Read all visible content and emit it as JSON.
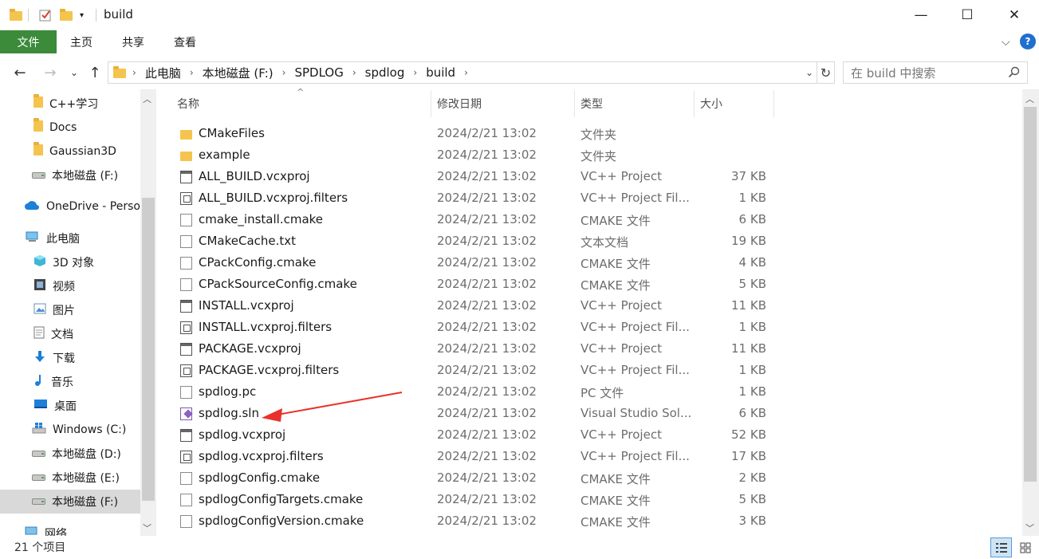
{
  "window": {
    "title": "build",
    "minimize_glyph": "—",
    "maximize_glyph": "☐",
    "close_glyph": "✕"
  },
  "ribbon": {
    "tabs": [
      "文件",
      "主页",
      "共享",
      "查看"
    ],
    "accent": "#3b8b3a",
    "expand_glyph": "⌵",
    "help_glyph": "?"
  },
  "nav": {
    "back": "←",
    "forward": "→",
    "recent": "⌄",
    "up": "↑",
    "breadcrumb": [
      "此电脑",
      "本地磁盘 (F:)",
      "SPDLOG",
      "spdlog",
      "build"
    ],
    "refresh": "↻"
  },
  "search": {
    "placeholder": "在 build 中搜索"
  },
  "sidebar": {
    "items": [
      {
        "label": "C++学习",
        "icon": "folder-icon"
      },
      {
        "label": "Docs",
        "icon": "folder-icon"
      },
      {
        "label": "Gaussian3D",
        "icon": "folder-icon"
      },
      {
        "label": "本地磁盘 (F:)",
        "icon": "drive-icon"
      },
      {
        "label": "OneDrive - Perso",
        "icon": "cloud-icon"
      },
      {
        "label": "此电脑",
        "icon": "computer-icon"
      },
      {
        "label": "3D 对象",
        "icon": "cube-icon"
      },
      {
        "label": "视频",
        "icon": "video-icon"
      },
      {
        "label": "图片",
        "icon": "picture-icon"
      },
      {
        "label": "文档",
        "icon": "document-icon"
      },
      {
        "label": "下载",
        "icon": "download-icon"
      },
      {
        "label": "音乐",
        "icon": "music-icon"
      },
      {
        "label": "桌面",
        "icon": "desktop-icon"
      },
      {
        "label": "Windows (C:)",
        "icon": "windows-drive-icon"
      },
      {
        "label": "本地磁盘 (D:)",
        "icon": "drive-icon"
      },
      {
        "label": "本地磁盘 (E:)",
        "icon": "drive-icon"
      },
      {
        "label": "本地磁盘 (F:)",
        "icon": "drive-icon"
      },
      {
        "label": "网络",
        "icon": "network-icon"
      }
    ]
  },
  "columns": {
    "name": "名称",
    "date": "修改日期",
    "type": "类型",
    "size": "大小"
  },
  "files": [
    {
      "name": "CMakeFiles",
      "date": "2024/2/21 13:02",
      "type": "文件夹",
      "size": "",
      "icon": "folder"
    },
    {
      "name": "example",
      "date": "2024/2/21 13:02",
      "type": "文件夹",
      "size": "",
      "icon": "folder"
    },
    {
      "name": "ALL_BUILD.vcxproj",
      "date": "2024/2/21 13:02",
      "type": "VC++ Project",
      "size": "37 KB",
      "icon": "proj"
    },
    {
      "name": "ALL_BUILD.vcxproj.filters",
      "date": "2024/2/21 13:02",
      "type": "VC++ Project Fil...",
      "size": "1 KB",
      "icon": "filt"
    },
    {
      "name": "cmake_install.cmake",
      "date": "2024/2/21 13:02",
      "type": "CMAKE 文件",
      "size": "6 KB",
      "icon": "doc"
    },
    {
      "name": "CMakeCache.txt",
      "date": "2024/2/21 13:02",
      "type": "文本文档",
      "size": "19 KB",
      "icon": "doc"
    },
    {
      "name": "CPackConfig.cmake",
      "date": "2024/2/21 13:02",
      "type": "CMAKE 文件",
      "size": "4 KB",
      "icon": "doc"
    },
    {
      "name": "CPackSourceConfig.cmake",
      "date": "2024/2/21 13:02",
      "type": "CMAKE 文件",
      "size": "5 KB",
      "icon": "doc"
    },
    {
      "name": "INSTALL.vcxproj",
      "date": "2024/2/21 13:02",
      "type": "VC++ Project",
      "size": "11 KB",
      "icon": "proj"
    },
    {
      "name": "INSTALL.vcxproj.filters",
      "date": "2024/2/21 13:02",
      "type": "VC++ Project Fil...",
      "size": "1 KB",
      "icon": "filt"
    },
    {
      "name": "PACKAGE.vcxproj",
      "date": "2024/2/21 13:02",
      "type": "VC++ Project",
      "size": "11 KB",
      "icon": "proj"
    },
    {
      "name": "PACKAGE.vcxproj.filters",
      "date": "2024/2/21 13:02",
      "type": "VC++ Project Fil...",
      "size": "1 KB",
      "icon": "filt"
    },
    {
      "name": "spdlog.pc",
      "date": "2024/2/21 13:02",
      "type": "PC 文件",
      "size": "1 KB",
      "icon": "doc"
    },
    {
      "name": "spdlog.sln",
      "date": "2024/2/21 13:02",
      "type": "Visual Studio Sol...",
      "size": "6 KB",
      "icon": "sln"
    },
    {
      "name": "spdlog.vcxproj",
      "date": "2024/2/21 13:02",
      "type": "VC++ Project",
      "size": "52 KB",
      "icon": "proj"
    },
    {
      "name": "spdlog.vcxproj.filters",
      "date": "2024/2/21 13:02",
      "type": "VC++ Project Fil...",
      "size": "17 KB",
      "icon": "filt"
    },
    {
      "name": "spdlogConfig.cmake",
      "date": "2024/2/21 13:02",
      "type": "CMAKE 文件",
      "size": "2 KB",
      "icon": "doc"
    },
    {
      "name": "spdlogConfigTargets.cmake",
      "date": "2024/2/21 13:02",
      "type": "CMAKE 文件",
      "size": "5 KB",
      "icon": "doc"
    },
    {
      "name": "spdlogConfigVersion.cmake",
      "date": "2024/2/21 13:02",
      "type": "CMAKE 文件",
      "size": "3 KB",
      "icon": "doc"
    }
  ],
  "status": {
    "count": "21 个项目"
  },
  "annotation": {
    "arrow_color": "#e8322b"
  }
}
